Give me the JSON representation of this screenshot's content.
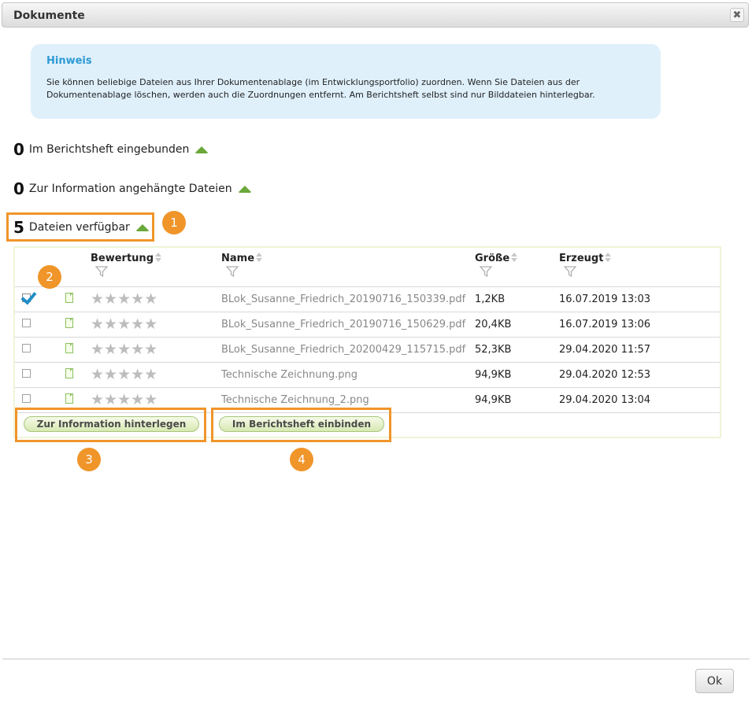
{
  "dialog": {
    "title": "Dokumente",
    "close_glyph": "✖",
    "ok_label": "Ok"
  },
  "hint": {
    "title": "Hinweis",
    "line1": "Sie können beliebige Dateien aus Ihrer Dokumentenablage (im Entwicklungsportfolio) zuordnen. Wenn Sie Dateien aus der",
    "line2": "Dokumentenablage löschen, werden auch die Zuordnungen entfernt. Am Berichtsheft selbst sind nur Bilddateien hinterlegbar."
  },
  "sections": [
    {
      "count": "0",
      "label": "Im Berichtsheft eingebunden"
    },
    {
      "count": "0",
      "label": "Zur Information angehängte Dateien"
    },
    {
      "count": "5",
      "label": "Dateien verfügbar"
    }
  ],
  "table": {
    "headers": {
      "rating": "Bewertung",
      "name": "Name",
      "size": "Größe",
      "created": "Erzeugt"
    },
    "rows": [
      {
        "checked": true,
        "stars": "★★★★★",
        "name": "BLok_Susanne_Friedrich_20190716_150339.pdf",
        "size": "1,2KB",
        "created": "16.07.2019 13:03"
      },
      {
        "checked": false,
        "stars": "★★★★★",
        "name": "BLok_Susanne_Friedrich_20190716_150629.pdf",
        "size": "20,4KB",
        "created": "16.07.2019 13:06"
      },
      {
        "checked": false,
        "stars": "★★★★★",
        "name": "BLok_Susanne_Friedrich_20200429_115715.pdf",
        "size": "52,3KB",
        "created": "29.04.2020 11:57"
      },
      {
        "checked": false,
        "stars": "★★★★★",
        "name": "Technische Zeichnung.png",
        "size": "94,9KB",
        "created": "29.04.2020 12:53"
      },
      {
        "checked": false,
        "stars": "★★★★★",
        "name": "Technische Zeichnung_2.png",
        "size": "94,9KB",
        "created": "29.04.2020 13:04"
      }
    ]
  },
  "buttons": {
    "info": "Zur Information hinterlegen",
    "embed": "Im Berichtsheft einbinden"
  },
  "badges": [
    "1",
    "2",
    "3",
    "4"
  ],
  "colors": {
    "accent_orange": "#f0952a",
    "hint_bg": "#dff0fb",
    "hint_title": "#2c9ad3",
    "arrow_green": "#6aa83a",
    "check_blue": "#1f8ec6"
  },
  "icons": {
    "close": "close-icon",
    "section_toggle": "arrow-up-icon",
    "sort": "sort-icon",
    "filter": "filter-icon",
    "file": "file-icon",
    "star": "star-icon"
  }
}
